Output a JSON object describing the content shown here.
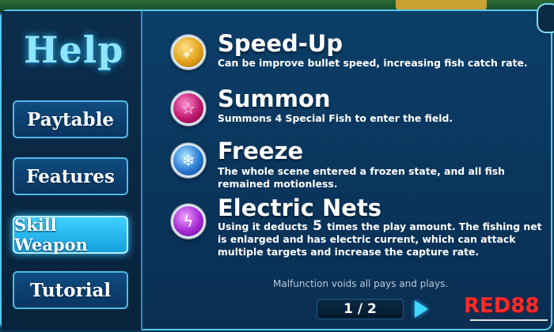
{
  "sidebar": {
    "title": "Help",
    "nav": [
      {
        "label": "Paytable",
        "active": false
      },
      {
        "label": "Features",
        "active": false
      },
      {
        "label": "Skill Weapon",
        "active": true
      },
      {
        "label": "Tutorial",
        "active": false
      }
    ]
  },
  "skills": [
    {
      "name": "Speed-Up",
      "icon": "speed-up-icon",
      "description": "Can be improve bullet speed, increasing fish catch rate."
    },
    {
      "name": "Summon",
      "icon": "pentagram-icon",
      "description": "Summons 4 Special Fish to enter the field."
    },
    {
      "name": "Freeze",
      "icon": "snowflake-icon",
      "description": "The whole scene entered a frozen state, and all fish remained motionless."
    },
    {
      "name": "Electric Nets",
      "icon": "electric-net-icon",
      "description_before": "Using it deducts",
      "description_number": "5",
      "description_after": "times the play amount. The fishing net is enlarged and has electric current, which can attack multiple targets and increase the capture rate."
    }
  ],
  "disclaimer": "Malfunction voids all pays and plays.",
  "pagination": {
    "current": 1,
    "total": 2,
    "label": "1 / 2"
  },
  "watermark": {
    "logo": "RED88"
  },
  "colors": {
    "accent_cyan": "#57c7ef",
    "active_button": "#3fd0ff",
    "panel_bg": "#0a2e52",
    "logo_red": "#ff2a2a"
  }
}
